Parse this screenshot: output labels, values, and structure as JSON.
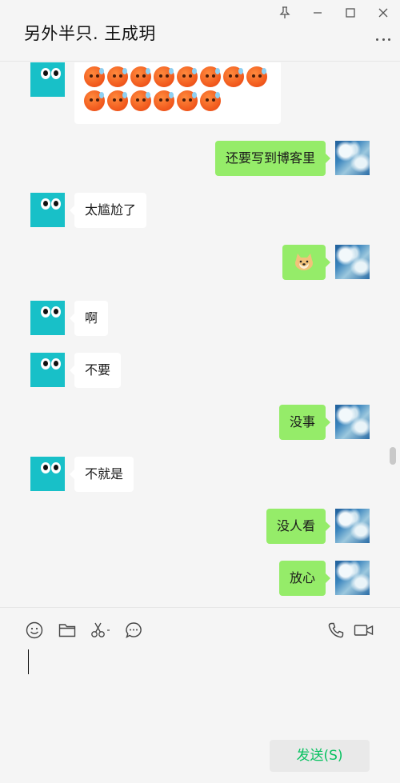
{
  "window": {
    "title": "另外半只. 王成玥"
  },
  "messages": [
    {
      "side": "left",
      "type": "emoji",
      "emoji_name": "sweat-face",
      "row1_count": 8,
      "row2_count": 6
    },
    {
      "side": "right",
      "type": "text",
      "text": "还要写到博客里"
    },
    {
      "side": "left",
      "type": "text",
      "text": "太尴尬了"
    },
    {
      "side": "right",
      "type": "emoji",
      "emoji_name": "doge"
    },
    {
      "side": "left",
      "type": "text",
      "text": "啊"
    },
    {
      "side": "left",
      "type": "text",
      "text": "不要"
    },
    {
      "side": "right",
      "type": "text",
      "text": "没事"
    },
    {
      "side": "left",
      "type": "text",
      "text": "不就是"
    },
    {
      "side": "right",
      "type": "text",
      "text": "没人看"
    },
    {
      "side": "right",
      "type": "text",
      "text": "放心"
    }
  ],
  "toolbar": {
    "icons": [
      "smiley-icon",
      "folder-icon",
      "scissors-icon",
      "chat-bubble-icon",
      "phone-icon",
      "video-call-icon"
    ]
  },
  "input": {
    "value": ""
  },
  "send_button": {
    "label": "发送(S)"
  },
  "colors": {
    "background": "#f5f5f5",
    "bubble_sent": "#95ec69",
    "bubble_received": "#ffffff",
    "send_text": "#07c160",
    "contact_avatar": "#18c0c8"
  }
}
